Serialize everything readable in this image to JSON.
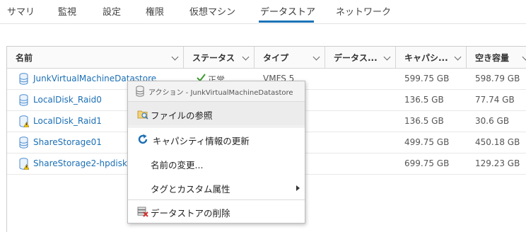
{
  "tabs": [
    "サマリ",
    "監視",
    "設定",
    "権限",
    "仮想マシン",
    "データストア",
    "ネットワーク"
  ],
  "columns": [
    "名前",
    "ステータス",
    "タイプ",
    "データス...",
    "キャパシ...",
    "空き容量"
  ],
  "rows": [
    {
      "name": "JunkVirtualMachineDatastore",
      "status": "正常",
      "type": "VMFS 5",
      "capacity": "599.75 GB",
      "free": "598.79 GB",
      "warning": false
    },
    {
      "name": "LocalDisk_Raid0",
      "status": "",
      "type": "",
      "capacity": "136.5 GB",
      "free": "77.74 GB",
      "warning": false
    },
    {
      "name": "LocalDisk_Raid1",
      "status": "",
      "type": "",
      "capacity": "136.5 GB",
      "free": "30.6 GB",
      "warning": true
    },
    {
      "name": "ShareStorage01",
      "status": "",
      "type": "",
      "capacity": "499.75 GB",
      "free": "450.18 GB",
      "warning": false
    },
    {
      "name": "ShareStorage2-hpdisk",
      "status": "",
      "type": "",
      "capacity": "699.75 GB",
      "free": "129.23 GB",
      "warning": true
    }
  ],
  "context_menu": {
    "header": "アクション - JunkVirtualMachineDatastore",
    "items": [
      {
        "label": "ファイルの参照",
        "icon": "browse-folder-icon",
        "highlighted": true
      },
      {
        "label": "キャパシティ情報の更新",
        "icon": "refresh-icon"
      },
      {
        "label": "名前の変更...",
        "icon": ""
      },
      {
        "label": "タグとカスタム属性",
        "icon": "",
        "submenu": true
      },
      {
        "label": "データストアの削除",
        "icon": "delete-datastore-icon"
      }
    ]
  },
  "colors": {
    "accent": "#1a73b8",
    "link": "#1b6fb5",
    "ok": "#3c9a2e",
    "warning": "#e8b400",
    "delete": "#d0312d"
  }
}
